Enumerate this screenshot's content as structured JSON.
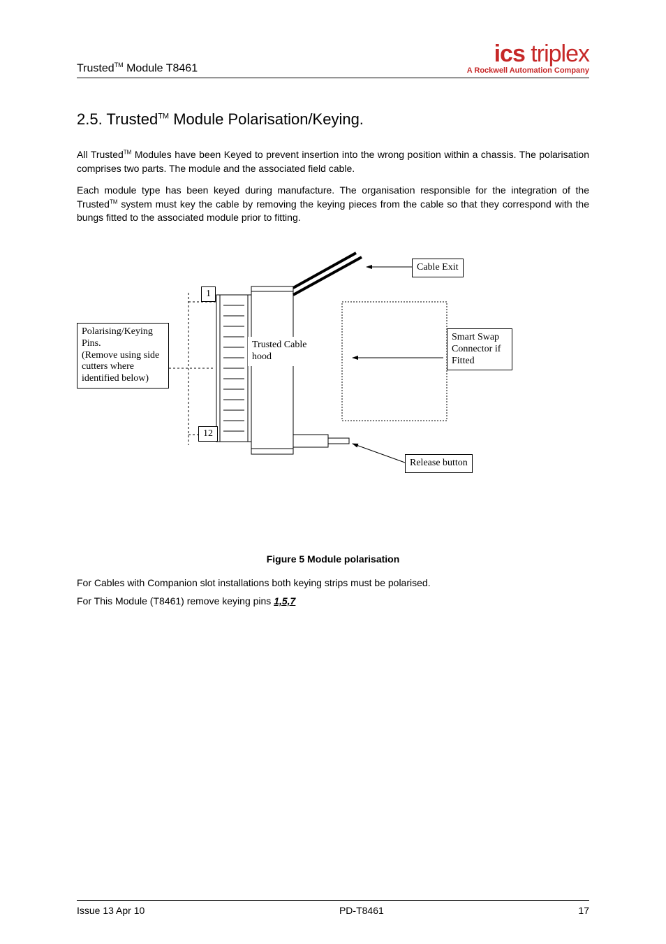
{
  "header": {
    "left_prefix": "Trusted",
    "left_tm": "TM",
    "left_suffix": " Module T8461",
    "logo_ics": "ics",
    "logo_triplex": " triplex",
    "logo_sub": "A Rockwell Automation Company"
  },
  "section": {
    "num": "2.5. ",
    "prefix": "Trusted",
    "tm": "TM",
    "suffix": " Module Polarisation/Keying."
  },
  "p1a": "All Trusted",
  "p1tm": "TM",
  "p1b": " Modules have been Keyed to prevent insertion into the wrong position within a chassis. The polarisation comprises two parts.  The module and the associated field cable.",
  "p2a": "Each module type has been keyed during manufacture. The organisation responsible for the integration of the Trusted",
  "p2tm": "TM",
  "p2b": " system must key the cable by removing the keying pieces from the cable so that they correspond with the bungs fitted to the associated module prior to fitting.",
  "diagram": {
    "pin_top": "1",
    "pin_bottom": "12",
    "keying_box": "Polarising/Keying Pins.\n(Remove using side cutters where identified below)",
    "hood": "Trusted Cable hood",
    "cable_exit": "Cable Exit",
    "smart_swap": "Smart Swap Connector if Fitted",
    "release": "Release button"
  },
  "caption": "Figure 5 Module polarisation",
  "line1": "For Cables with Companion slot installations both keying strips must be polarised.",
  "line2a": "For This Module (T8461) remove keying pins  ",
  "line2b": "1,5,7",
  "footer": {
    "left": "Issue 13 Apr 10",
    "center": "PD-T8461",
    "right": "17"
  }
}
